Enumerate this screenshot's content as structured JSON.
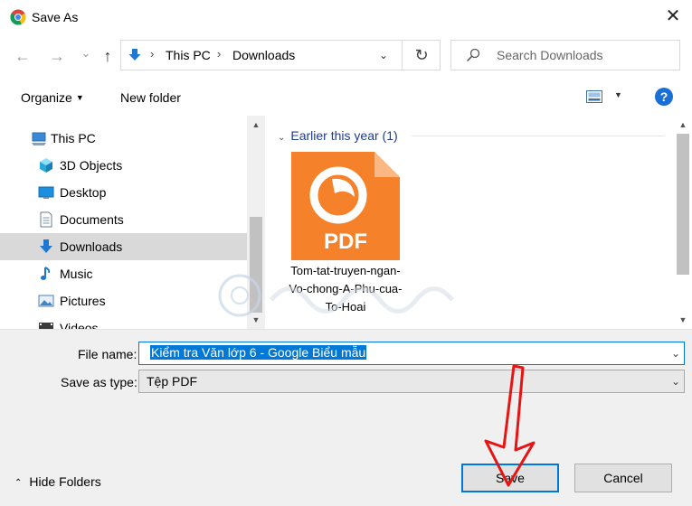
{
  "window": {
    "title": "Save As",
    "close_glyph": "✕",
    "app_icon": "chrome-icon"
  },
  "nav": {
    "back_glyph": "←",
    "forward_glyph": "→",
    "recent_glyph": "⌄",
    "up_glyph": "↑",
    "breadcrumb": [
      "This PC",
      "Downloads"
    ],
    "separator": "›",
    "dropdown_glyph": "⌄",
    "refresh_glyph": "↻"
  },
  "search": {
    "placeholder": "Search Downloads"
  },
  "toolbar": {
    "organize_label": "Organize",
    "organize_caret": "▼",
    "new_folder_label": "New folder",
    "view_caret": "▼",
    "help_label": "?"
  },
  "sidebar": {
    "items": [
      {
        "label": "This PC",
        "icon": "computer-icon"
      },
      {
        "label": "3D Objects",
        "icon": "cube-icon"
      },
      {
        "label": "Desktop",
        "icon": "desktop-icon"
      },
      {
        "label": "Documents",
        "icon": "document-icon"
      },
      {
        "label": "Downloads",
        "icon": "download-icon",
        "selected": true
      },
      {
        "label": "Music",
        "icon": "music-icon"
      },
      {
        "label": "Pictures",
        "icon": "pictures-icon"
      },
      {
        "label": "Videos",
        "icon": "video-icon"
      }
    ]
  },
  "content": {
    "group_label": "Earlier this year (1)",
    "group_chevron": "⌄",
    "file": {
      "name": "Tom-tat-truyen-ngan-Vo-chong-A-Phu-cua-To-Hoai",
      "icon_text": "PDF",
      "icon": "foxit-pdf-icon"
    }
  },
  "form": {
    "file_name_label": "File name:",
    "file_name_value": "Kiểm tra Văn lớp 6 - Google Biểu mẫu",
    "save_as_type_label": "Save as type:",
    "save_as_type_value": "Tệp PDF",
    "dropdown_glyph": "⌄"
  },
  "footer": {
    "hide_folders_glyph": "⌃",
    "hide_folders_label": "Hide Folders",
    "save_label": "Save",
    "cancel_label": "Cancel"
  },
  "colors": {
    "accent": "#0078d7",
    "selection": "#d9d9d9",
    "annotation_arrow": "#e81313",
    "pdf_icon": "#f5822a"
  },
  "scroll": {
    "sidebar_position": 0.5,
    "content_position": 0.0
  }
}
